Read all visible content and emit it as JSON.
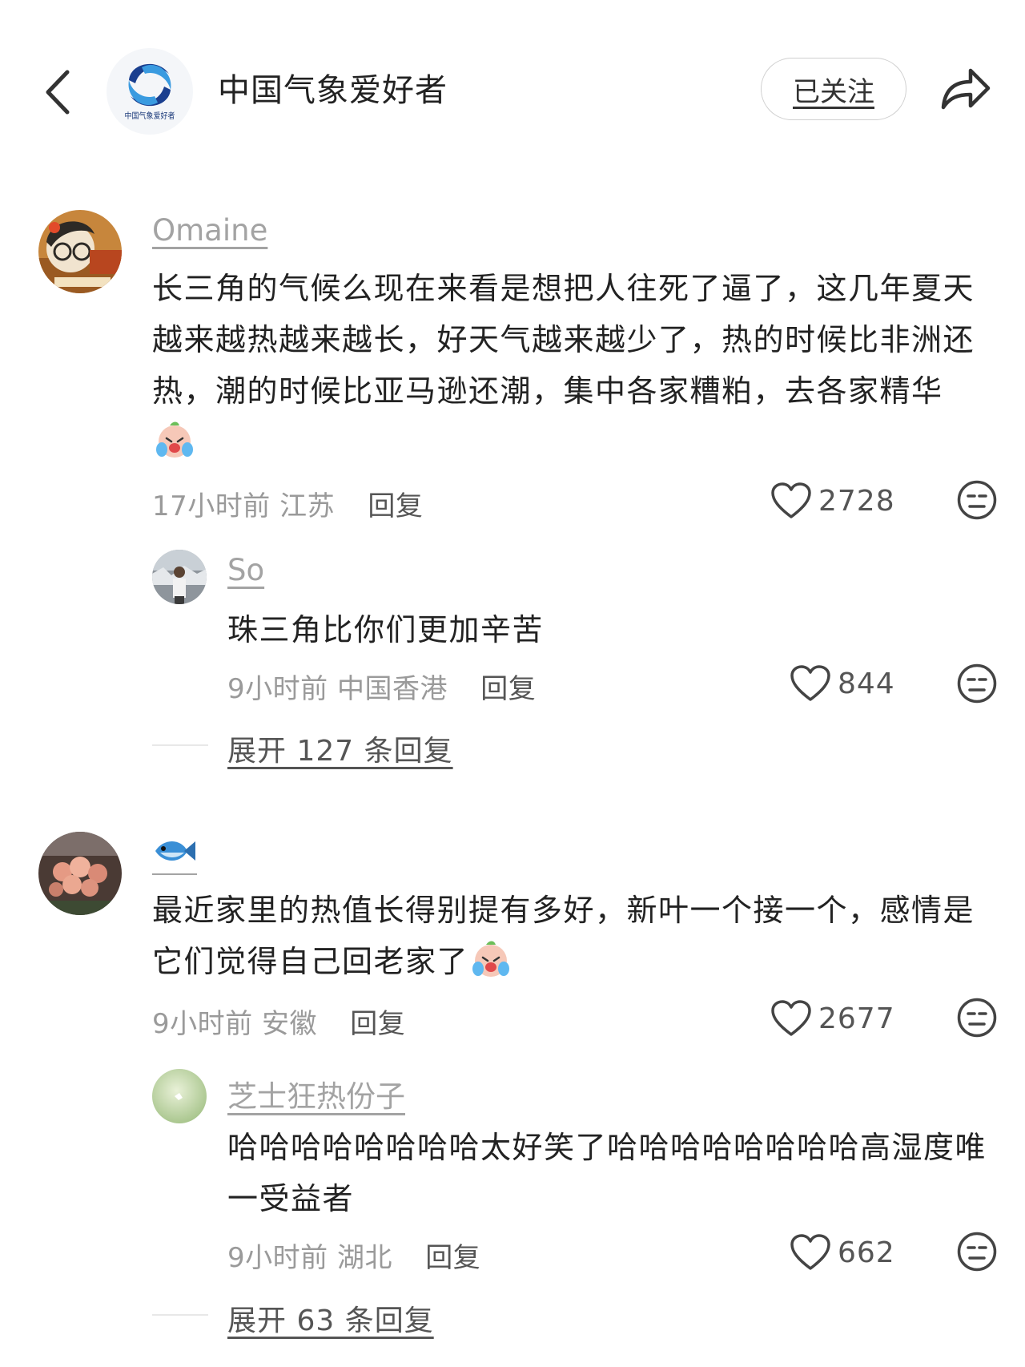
{
  "header": {
    "back_icon": "chevron-left-icon",
    "channel_title": "中国气象爱好者",
    "logo_text": "中国气象爱好者",
    "follow_label": "已关注",
    "share_icon": "share-arrow-icon"
  },
  "comments": [
    {
      "username": "Omaine",
      "text": "长三角的气候么现在来看是想把人往死了逼了，这几年夏天越来越热越来越长，好天气越来越少了，热的时候比非洲还热，潮的时候比亚马逊还潮，集中各家糟粕，去各家精华",
      "emoji": "crying-laughing-face-emoji",
      "time": "17小时前",
      "location": "江苏",
      "reply_label": "回复",
      "likes": "2728",
      "reply": {
        "username": "So",
        "text": "珠三角比你们更加辛苦",
        "time": "9小时前",
        "location": "中国香港",
        "reply_label": "回复",
        "likes": "844"
      },
      "expand_label": "展开 127 条回复"
    },
    {
      "username": "🐟",
      "text": "最近家里的热值长得别提有多好，新叶一个接一个，感情是它们觉得自己回老家了",
      "emoji": "crying-laughing-face-emoji",
      "time": "9小时前",
      "location": "安徽",
      "reply_label": "回复",
      "likes": "2677",
      "reply": {
        "username": "芝士狂热份子",
        "text": "哈哈哈哈哈哈哈哈太好笑了哈哈哈哈哈哈哈哈高湿度唯一受益者",
        "time": "9小时前",
        "location": "湖北",
        "reply_label": "回复",
        "likes": "662"
      },
      "expand_label": "展开 63 条回复"
    }
  ]
}
